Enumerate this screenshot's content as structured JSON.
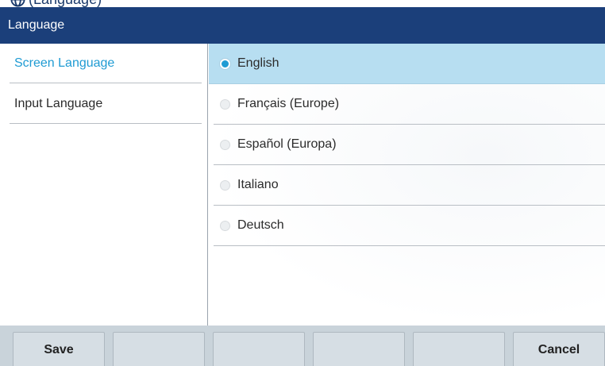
{
  "caption": {
    "icon": "globe-icon",
    "text": "(Language)"
  },
  "window": {
    "title": "Language"
  },
  "left_menu": {
    "items": [
      {
        "label": "Screen Language",
        "active": true
      },
      {
        "label": "Input Language",
        "active": false
      }
    ]
  },
  "options": {
    "items": [
      {
        "label": "English",
        "selected": true
      },
      {
        "label": "Français (Europe)",
        "selected": false
      },
      {
        "label": "Español (Europa)",
        "selected": false
      },
      {
        "label": "Italiano",
        "selected": false
      },
      {
        "label": "Deutsch",
        "selected": false
      }
    ]
  },
  "softkeys": [
    "Save",
    "",
    "",
    "",
    "",
    "Cancel"
  ],
  "colors": {
    "title_bar": "#1b3f7a",
    "accent": "#1f9bd3",
    "selection": "#b7def1",
    "softkey_bar": "#c9d3da"
  }
}
